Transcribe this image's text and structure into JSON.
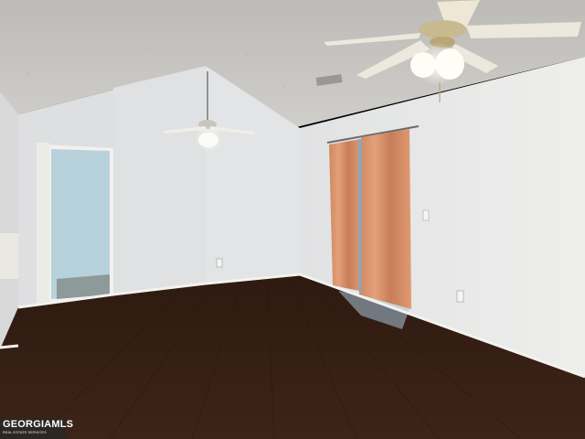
{
  "scene": {
    "description_tags": [
      "empty-room",
      "vaulted-ceiling",
      "hardwood-floor",
      "ceiling-fans",
      "curtained-window",
      "open-doorway"
    ],
    "colors": {
      "ceiling": "#c9c7c3",
      "wall_left": "#dcdcdc",
      "wall_center": "#e4e5e6",
      "wall_right": "#e8e8e6",
      "floor": "#3a2216",
      "curtain": "#d9916a",
      "doorway_interior": "#b9d4dc",
      "trim": "#f0efeb"
    }
  },
  "watermark": {
    "brand": "GEORGIAMLS",
    "tagline": "REAL ESTATE SERVICES"
  }
}
